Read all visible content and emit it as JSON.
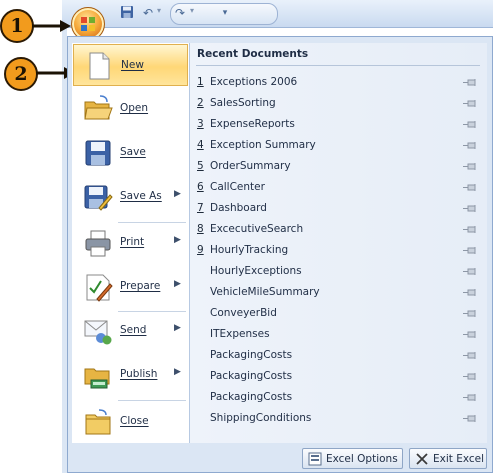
{
  "callouts": [
    "1",
    "2"
  ],
  "menu": {
    "items": [
      {
        "label": "New",
        "icon": "new-document-icon",
        "submenu": false,
        "active": true
      },
      {
        "label": "Open",
        "icon": "open-folder-icon",
        "submenu": false
      },
      {
        "label": "Save",
        "icon": "floppy-disk-icon",
        "submenu": false
      },
      {
        "label": "Save As",
        "icon": "save-as-icon",
        "submenu": true
      },
      {
        "label": "Print",
        "icon": "printer-icon",
        "submenu": true
      },
      {
        "label": "Prepare",
        "icon": "prepare-document-icon",
        "submenu": true
      },
      {
        "label": "Send",
        "icon": "send-icon",
        "submenu": true
      },
      {
        "label": "Publish",
        "icon": "publish-icon",
        "submenu": true
      },
      {
        "label": "Close",
        "icon": "close-folder-icon",
        "submenu": false
      }
    ],
    "submenu_arrow": "▶"
  },
  "recent": {
    "title": "Recent Documents",
    "documents": [
      {
        "num": "1",
        "name": "Exceptions 2006"
      },
      {
        "num": "2",
        "name": "SalesSorting"
      },
      {
        "num": "3",
        "name": "ExpenseReports"
      },
      {
        "num": "4",
        "name": "Exception Summary"
      },
      {
        "num": "5",
        "name": "OrderSummary"
      },
      {
        "num": "6",
        "name": "CallCenter"
      },
      {
        "num": "7",
        "name": "Dashboard"
      },
      {
        "num": "8",
        "name": "ExcecutiveSearch"
      },
      {
        "num": "9",
        "name": "HourlyTracking"
      },
      {
        "num": "",
        "name": "HourlyExceptions"
      },
      {
        "num": "",
        "name": "VehicleMileSummary"
      },
      {
        "num": "",
        "name": "ConveyerBid"
      },
      {
        "num": "",
        "name": "ITExpenses"
      },
      {
        "num": "",
        "name": "PackagingCosts"
      },
      {
        "num": "",
        "name": "PackagingCosts"
      },
      {
        "num": "",
        "name": "PackagingCosts"
      },
      {
        "num": "",
        "name": "ShippingConditions"
      }
    ]
  },
  "footer": {
    "options_label": "Excel Options",
    "exit_label": "Exit Excel"
  },
  "colors": {
    "accent": "#f29b1d",
    "menu_bg": "#dbe6f4",
    "highlight": "#ffd777"
  }
}
